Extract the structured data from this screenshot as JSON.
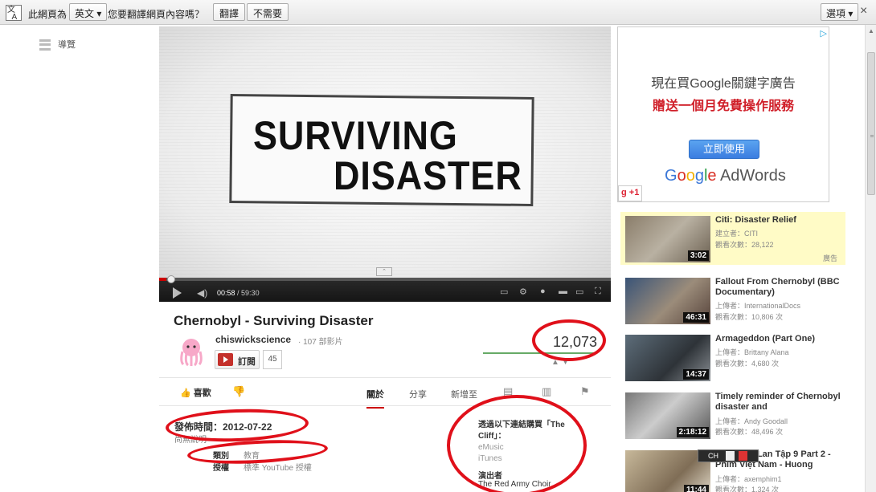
{
  "translate_bar": {
    "prefix": "此網頁為",
    "language": "英文",
    "question": "您要翻譯網頁內容嗎？",
    "translate_btn": "翻譯",
    "decline_btn": "不需要",
    "options_btn": "選項",
    "close": "×"
  },
  "guide": {
    "label": "導覽"
  },
  "video": {
    "title_line1": "SURVIVING",
    "title_line2": "DISASTER",
    "current_time": "00:58",
    "duration": "/ 59:30",
    "progress": 0.016
  },
  "watch": {
    "title": "Chernobyl - Surviving Disaster",
    "channel": "chiswickscience",
    "video_count": "· 107 部影片",
    "subscribe": "訂閱",
    "subscriber_count": "45",
    "views": "12,073",
    "like_label": "喜歡",
    "tabs": [
      "關於",
      "分享",
      "新增至"
    ],
    "active_tab": "關於"
  },
  "details": {
    "published": "發佈時間：2012-07-22",
    "subtitle": "尚無說明",
    "category_key": "類別",
    "category_val": "教育",
    "license_key": "授權",
    "license_val": "標準 YouTube 授權",
    "buy_title": "透過以下連結購買「The Cliff」：",
    "buy_links": [
      "eMusic",
      "iTunes"
    ],
    "performer_key": "演出者",
    "performer_val": "The Red Army Choir"
  },
  "ad": {
    "line1": "現在買Google關鍵字廣告",
    "line2": "贈送一個月免費操作服務",
    "cta": "立即使用",
    "logo_rest": " AdWords",
    "plus": "+1"
  },
  "sidebar": [
    {
      "title": "Citi: Disaster Relief",
      "by": "建立者：CITI",
      "views": "觀看次數：28,122",
      "duration": "3:02",
      "ad": "廣告"
    },
    {
      "title": "Fallout From Chernobyl (BBC Documentary)",
      "by": "上傳者：InternationalDocs",
      "views": "觀看次數：10,806 次",
      "duration": "46:31"
    },
    {
      "title": "Armageddon (Part One)",
      "by": "上傳者：Brittany Alana",
      "views": "觀看次數：4,680 次",
      "duration": "14:37"
    },
    {
      "title": "Timely reminder of Chernobyl disaster and",
      "by": "上傳者：Andy Goodall",
      "views": "觀看次數：48,496 次",
      "duration": "2:18:12"
    },
    {
      "title": "Phim Lạc Lan Tập 9 Part 2 - Phim Việt Nam - Huong",
      "by": "上傳者：axemphim1",
      "views": "觀看次數：1,324 次",
      "duration": "11:44"
    }
  ],
  "ime": {
    "label": "CH"
  }
}
